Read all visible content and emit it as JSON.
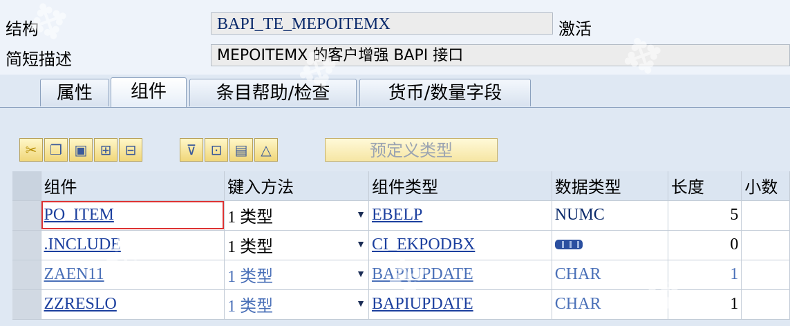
{
  "header": {
    "structure_label": "结构",
    "structure_value": "BAPI_TE_MEPOITEMX",
    "status": "激活",
    "desc_label": "简短描述",
    "desc_value": "MEPOITEMX 的客户增强 BAPI 接口"
  },
  "tabs": [
    {
      "label": "属性"
    },
    {
      "label": "组件"
    },
    {
      "label": "条目帮助/检查"
    },
    {
      "label": "货币/数量字段"
    }
  ],
  "toolbar": {
    "predefined_type_label": "预定义类型"
  },
  "table": {
    "columns": [
      "组件",
      "键入方法",
      "组件类型",
      "数据类型",
      "长度",
      "小数"
    ],
    "rows": [
      {
        "component": "PO_ITEM",
        "key_method": "1 类型",
        "component_type": "EBELP",
        "data_type": "NUMC",
        "length": "5"
      },
      {
        "component": ".INCLUDE",
        "key_method": "1 类型",
        "component_type": "CI_EKPODBX",
        "data_type": "",
        "length": "0"
      },
      {
        "component": "ZAEN11",
        "key_method": "1 类型",
        "component_type": "BAPIUPDATE",
        "data_type": "CHAR",
        "length": "1"
      },
      {
        "component": "ZZRESLO",
        "key_method": "1 类型",
        "component_type": "BAPIUPDATE",
        "data_type": "CHAR",
        "length": "1"
      }
    ]
  },
  "colors": {
    "link": "#1b3f9e",
    "background": "#dfe8f3"
  }
}
